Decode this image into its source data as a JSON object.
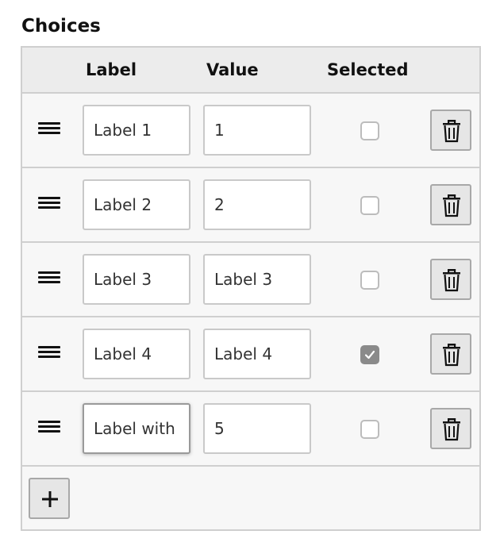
{
  "section": {
    "title": "Choices"
  },
  "columns": {
    "label": "Label",
    "value": "Value",
    "selected": "Selected"
  },
  "choices": [
    {
      "label": "Label 1",
      "value": "1",
      "selected": false
    },
    {
      "label": "Label 2",
      "value": "2",
      "selected": false
    },
    {
      "label": "Label 3",
      "value": "Label 3",
      "selected": false
    },
    {
      "label": "Label 4",
      "value": "Label 4",
      "selected": true
    },
    {
      "label": "Label with",
      "value": "5",
      "selected": false
    }
  ],
  "icons": {
    "drag": "drag-handle-icon",
    "delete": "trash-icon",
    "add": "plus-icon",
    "check": "checkmark-icon"
  },
  "colors": {
    "border": "#cfcfcf",
    "header_bg": "#ececec",
    "row_bg": "#f7f7f7",
    "checked_bg": "#8a8a8a"
  }
}
